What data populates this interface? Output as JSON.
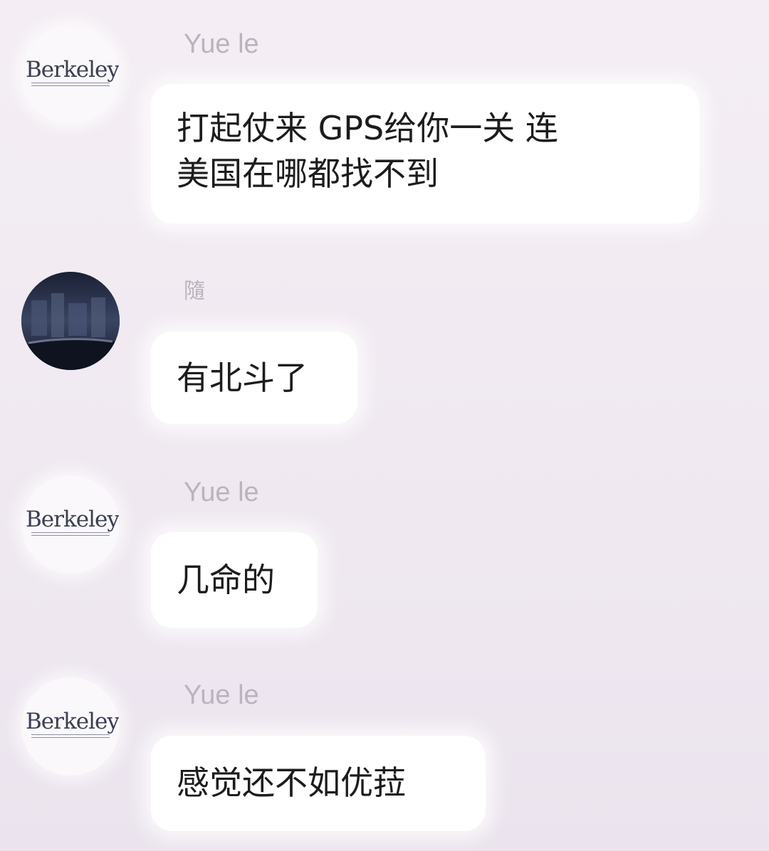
{
  "messages": [
    {
      "sender": "Yue le",
      "avatar": "Berkeley",
      "text": "打起仗来 GPS给你一关 连\n美国在哪都找不到"
    },
    {
      "sender": "隨",
      "avatar": "night-scene-avatar",
      "text": "有北斗了"
    },
    {
      "sender": "Yue le",
      "avatar": "Berkeley",
      "text": "几命的"
    },
    {
      "sender": "Yue le",
      "avatar": "Berkeley",
      "text": "感觉还不如优菈"
    }
  ],
  "colors": {
    "background": "#f2ecf3",
    "bubble": "#ffffff",
    "sender_name": "#b9b4be",
    "message_text": "#1c1c1e"
  }
}
